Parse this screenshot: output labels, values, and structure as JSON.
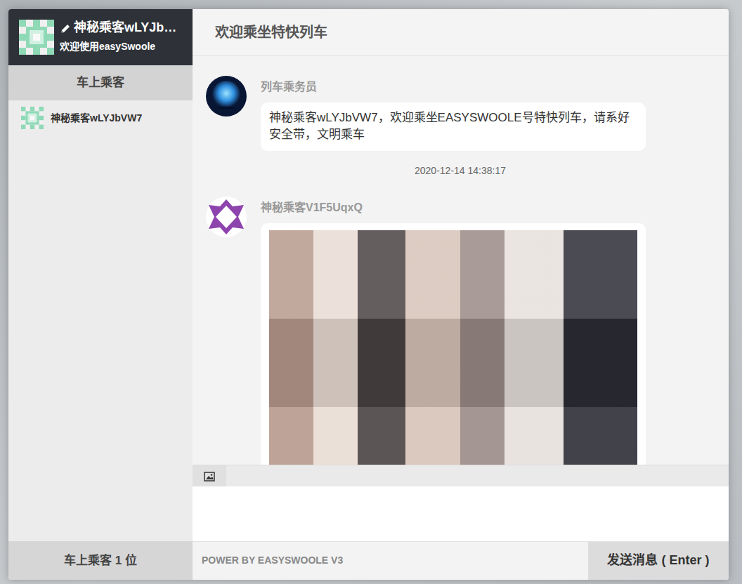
{
  "user": {
    "name": "神秘乘客wLYJb…",
    "signature": "欢迎使用easySwoole"
  },
  "sidebar": {
    "tab": "车上乘客",
    "items": [
      {
        "name": "神秘乘客wLYJbVW7"
      }
    ],
    "count": "车上乘客 1 位"
  },
  "chat": {
    "title": "欢迎乘坐特快列车",
    "messages": [
      {
        "kind": "text",
        "avatar": "moon",
        "sender": "列车乘务员",
        "text": "神秘乘客wLYJbVW7，欢迎乘坐EASYSWOOLE号特快列车，请系好安全带，文明乘车"
      },
      {
        "kind": "time",
        "text": "2020-12-14 14:38:17"
      },
      {
        "kind": "image",
        "avatar": "diamond",
        "sender": "神秘乘客V1F5UqxQ"
      }
    ]
  },
  "footer": {
    "power": "POWER BY EASYSWOOLE V3",
    "send": "发送消息 ( Enter )"
  }
}
